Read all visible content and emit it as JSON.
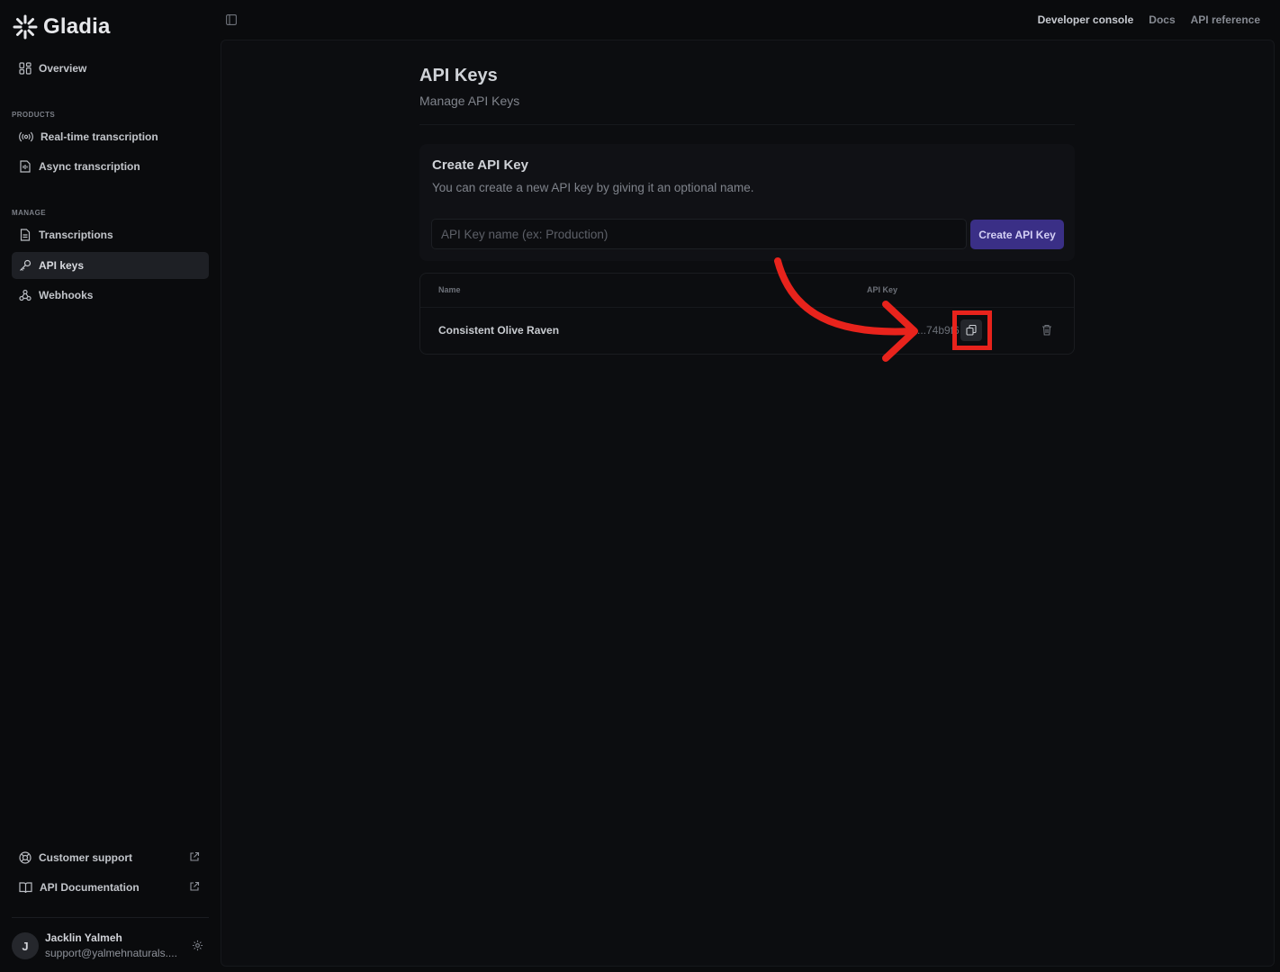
{
  "brand": {
    "name": "Gladia"
  },
  "sidebar": {
    "overview": "Overview",
    "products_label": "PRODUCTS",
    "products": [
      {
        "label": "Real-time transcription",
        "icon": "radio-icon"
      },
      {
        "label": "Async transcription",
        "icon": "file-audio-icon"
      }
    ],
    "manage_label": "MANAGE",
    "manage": [
      {
        "label": "Transcriptions",
        "icon": "document-icon"
      },
      {
        "label": "API keys",
        "icon": "key-icon",
        "active": true
      },
      {
        "label": "Webhooks",
        "icon": "webhook-icon"
      }
    ],
    "footer_links": [
      {
        "label": "Customer support",
        "icon": "lifebuoy-icon"
      },
      {
        "label": "API Documentation",
        "icon": "book-icon"
      }
    ],
    "user": {
      "initial": "J",
      "name": "Jacklin Yalmeh",
      "email": "support@yalmehnaturals...."
    }
  },
  "topbar": {
    "links": [
      "Developer console",
      "Docs",
      "API reference"
    ]
  },
  "page": {
    "title": "API Keys",
    "subtitle": "Manage API Keys"
  },
  "create_card": {
    "title": "Create API Key",
    "description": "You can create a new API key by giving it an optional name.",
    "input_placeholder": "API Key name (ex: Production)",
    "button_label": "Create API Key"
  },
  "keys_table": {
    "columns": [
      "Name",
      "API Key"
    ],
    "rows": [
      {
        "name": "Consistent Olive Raven",
        "key_masked": "...74b9f6"
      }
    ]
  },
  "colors": {
    "accent": "#3a2f86",
    "annotation": "#e8231c",
    "background": "#0a0b0d"
  }
}
